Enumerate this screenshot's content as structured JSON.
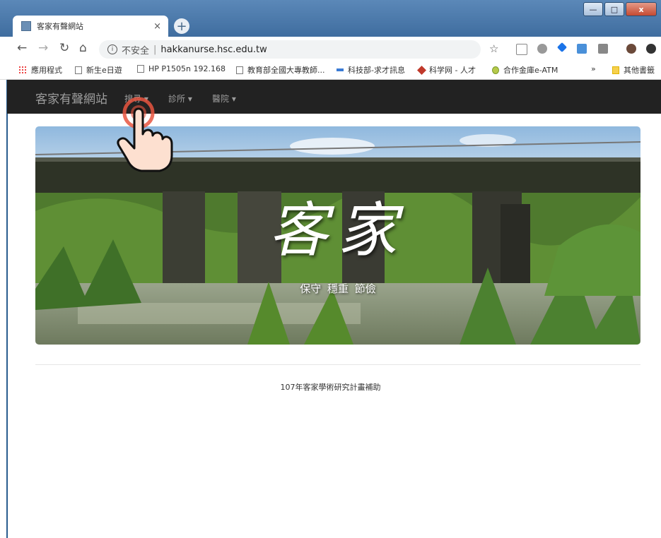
{
  "browser": {
    "tab_title": "客家有聲網站",
    "tab_close": "×",
    "new_tab": "+",
    "omnibox": {
      "security_label": "不安全",
      "separator": "|",
      "url": "hakkanurse.hsc.edu.tw"
    },
    "window_controls": [
      "—",
      "□",
      "x"
    ],
    "bookmarks": [
      "應用程式",
      "新生e日遊",
      "HP P1505n 192.168",
      "教育部全國大專教師...",
      "科技部-求才訊息",
      "科学网 - 人才",
      "合作金庫e-ATM"
    ],
    "more_bookmarks": "»",
    "other_bookmarks": "其他書籤"
  },
  "site": {
    "brand": "客家有聲網站",
    "nav": [
      {
        "label": "搜尋 ▾"
      },
      {
        "label": "診所 ▾"
      },
      {
        "label": "醫院 ▾"
      }
    ],
    "hero": {
      "title": "客家",
      "subtitle": "保守  穩重  節儉"
    },
    "footer": "107年客家學術研究計畫補助"
  },
  "colors": {
    "navbar_bg": "#222222",
    "nav_text": "#9d9d9d",
    "titlebar": "#4a79ab",
    "tap_ring": "#e8553f"
  },
  "icons": [
    "back-arrow-icon",
    "forward-arrow-icon",
    "reload-icon",
    "home-icon",
    "info-icon",
    "star-icon",
    "tap-hand-icon"
  ]
}
